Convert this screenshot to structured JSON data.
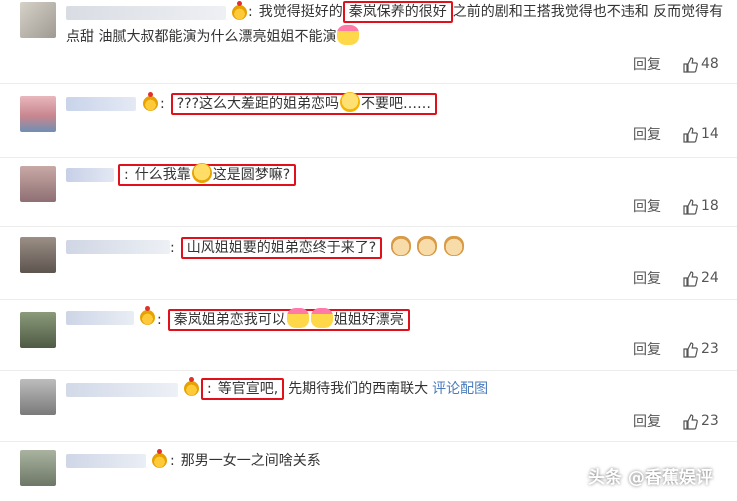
{
  "reply_label": "回复",
  "comments": [
    {
      "pre": "我觉得挺好的",
      "hl": "秦岚保养的很好",
      "post": "之前的剧和王搭我觉得也不违和 反而觉得有",
      "line2": "点甜 油腻大叔都能演为什么漂亮姐姐不能演",
      "likes": "48"
    },
    {
      "hl": "???这么大差距的姐弟恋吗",
      "hl2": "不要吧……",
      "likes": "14"
    },
    {
      "hl": "什么我靠",
      "hl2": "这是圆梦嘛?",
      "likes": "18"
    },
    {
      "hl": "山风姐姐要的姐弟恋终于来了?",
      "likes": "24"
    },
    {
      "hl": "秦岚姐弟恋我可以",
      "hl2": "姐姐好漂亮",
      "likes": "23"
    },
    {
      "hl": "等官宣吧,",
      "post": "先期待我们的西南联大",
      "link": "评论配图",
      "likes": "23"
    },
    {
      "text": "那男一女一之间啥关系"
    }
  ],
  "watermark": "头条 @香蕉娱评"
}
